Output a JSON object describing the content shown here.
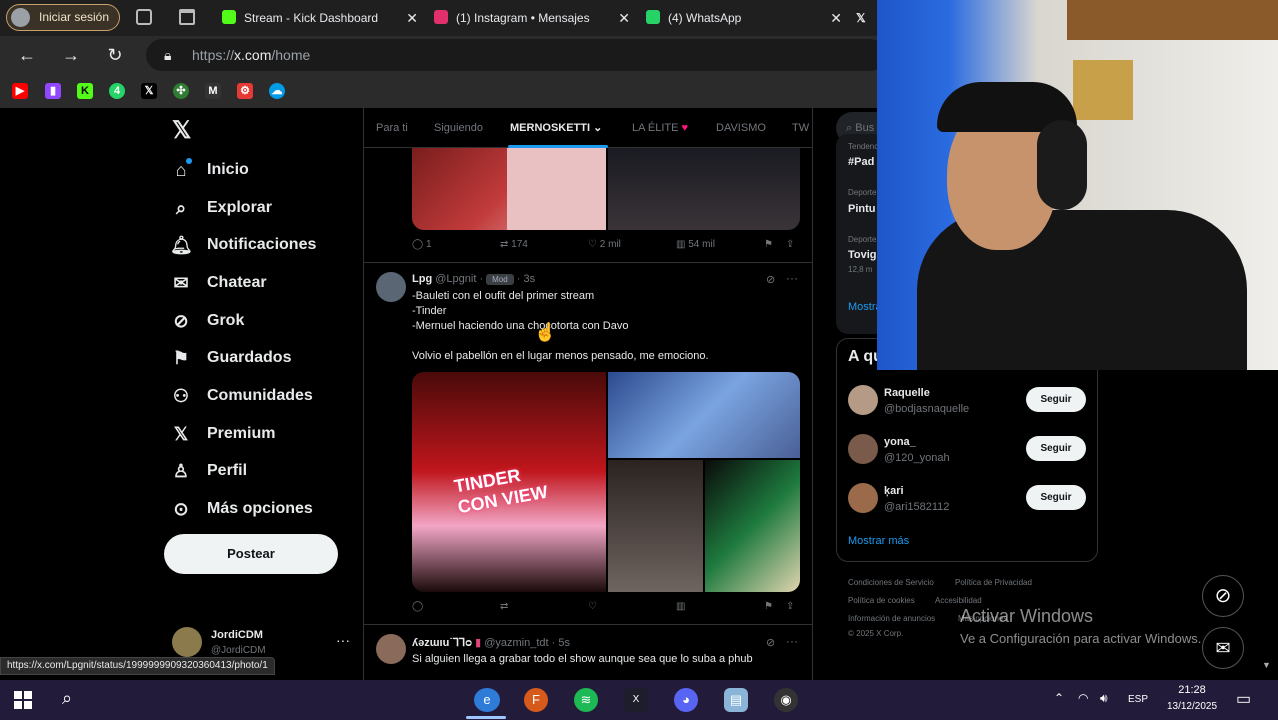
{
  "browser": {
    "signin_label": "Iniciar sesión",
    "tabs": [
      {
        "title": "Stream - Kick Dashboard",
        "color": "#53fc18"
      },
      {
        "title": "(1) Instagram • Mensajes",
        "color": "#e1306c"
      },
      {
        "title": "(4) WhatsApp",
        "color": "#25d366"
      }
    ],
    "url_prefix": "https://",
    "url_host": "x.com",
    "url_path": "/home"
  },
  "sidebar": {
    "items": [
      {
        "label": "Inicio",
        "icon": "home-icon",
        "glyph": "⌂"
      },
      {
        "label": "Explorar",
        "icon": "search-icon",
        "glyph": "⌕"
      },
      {
        "label": "Notificaciones",
        "icon": "bell-icon",
        "glyph": "🔔︎"
      },
      {
        "label": "Chatear",
        "icon": "mail-icon",
        "glyph": "✉"
      },
      {
        "label": "Grok",
        "icon": "grok-icon",
        "glyph": "⊘"
      },
      {
        "label": "Guardados",
        "icon": "bookmark-icon",
        "glyph": "⚑"
      },
      {
        "label": "Comunidades",
        "icon": "communities-icon",
        "glyph": "⚇"
      },
      {
        "label": "Premium",
        "icon": "x-icon",
        "glyph": "𝕏"
      },
      {
        "label": "Perfil",
        "icon": "profile-icon",
        "glyph": "♙"
      },
      {
        "label": "Más opciones",
        "icon": "more-icon",
        "glyph": "⊙"
      }
    ],
    "post_label": "Postear",
    "account_name": "JordiCDM",
    "account_handle": "@JordiCDM"
  },
  "feed": {
    "tabs": [
      "Para ti",
      "Siguiendo",
      "MERNOSKETTI",
      "LA ÉLITE",
      "DAVISMO",
      "TW"
    ],
    "active_tab": "MERNOSKETTI",
    "post1_actions": {
      "replies": "1",
      "reposts": "174",
      "likes": "2 mil",
      "views": "54 mil"
    },
    "post2": {
      "author": "Lpg",
      "handle": "@Lpgnit",
      "badge": "Mod",
      "time": "3s",
      "lines": [
        "-Bauleti con el oufit del primer stream",
        "-Tinder",
        "-Mernuel haciendo una chocotorta con Davo"
      ],
      "body": "Volvio el pabellón en el lugar menos pensado, me emociono."
    },
    "post3": {
      "author": "ʎǝzɯıu˙ꞀꞀᴑ",
      "handle": "@yazmin_tdt",
      "time": "5s",
      "text": "Si alguien llega a grabar todo el show aunque sea que lo suba a phub"
    },
    "status_url": "https://x.com/Lpgnit/status/1999999909320360413/photo/1"
  },
  "right": {
    "search_placeholder": "Bus",
    "trends": [
      {
        "context": "Tendencia",
        "name": "#Pad"
      },
      {
        "context": "Deportes",
        "name": "Pintu"
      },
      {
        "context": "Deportes",
        "name": "Tovig",
        "count": "12,8 m"
      }
    ],
    "show_more": "Mostrar",
    "who_to_follow_title": "A qu",
    "suggestions": [
      {
        "name": "Raquelle",
        "handle": "@bodjasnaquelle"
      },
      {
        "name": "yona_",
        "handle": "@120_yonah"
      },
      {
        "name": "ķari",
        "handle": "@ari1582112"
      }
    ],
    "follow_label": "Seguir",
    "show_more_full": "Mostrar más",
    "footer": [
      "Condiciones de Servicio",
      "Política de Privacidad",
      "Política de cookies",
      "Accesibilidad",
      "Información de anuncios",
      "Más opciones",
      "© 2025 X Corp."
    ]
  },
  "watermark": {
    "line1": "Activar Windows",
    "line2": "Ve a Configuración para activar Windows."
  },
  "taskbar": {
    "lang": "ESP",
    "time": "21:28",
    "date": "13/12/2025"
  }
}
